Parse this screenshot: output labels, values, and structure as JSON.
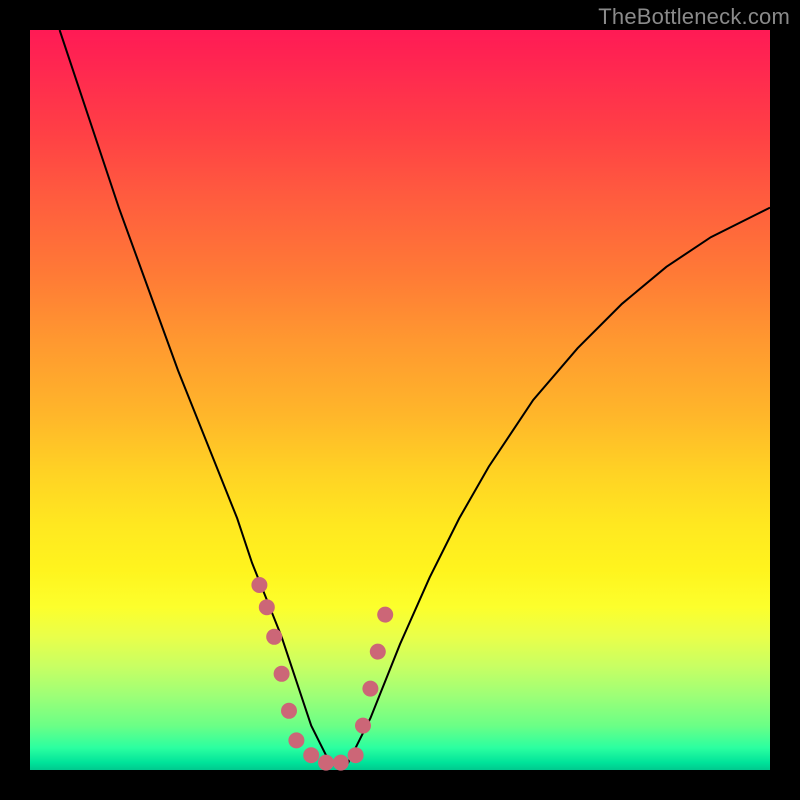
{
  "watermark": "TheBottleneck.com",
  "colors": {
    "background": "#000000",
    "curve": "#000000",
    "markers": "#cc6677",
    "gradient_top": "#ff1a55",
    "gradient_bottom": "#00c98e"
  },
  "chart_data": {
    "type": "line",
    "title": "",
    "xlabel": "",
    "ylabel": "",
    "xlim": [
      0,
      100
    ],
    "ylim": [
      0,
      100
    ],
    "x": [
      4,
      8,
      12,
      16,
      20,
      24,
      28,
      30,
      32,
      34,
      35,
      36,
      37,
      38,
      39,
      40,
      41,
      42,
      43,
      44,
      46,
      48,
      50,
      54,
      58,
      62,
      68,
      74,
      80,
      86,
      92,
      98,
      100
    ],
    "values": [
      100,
      88,
      76,
      65,
      54,
      44,
      34,
      28,
      23,
      18,
      15,
      12,
      9,
      6,
      4,
      2,
      1,
      0,
      1,
      3,
      7,
      12,
      17,
      26,
      34,
      41,
      50,
      57,
      63,
      68,
      72,
      75,
      76
    ],
    "marker_points": [
      {
        "x": 31,
        "y": 25
      },
      {
        "x": 32,
        "y": 22
      },
      {
        "x": 33,
        "y": 18
      },
      {
        "x": 34,
        "y": 13
      },
      {
        "x": 35,
        "y": 8
      },
      {
        "x": 36,
        "y": 4
      },
      {
        "x": 38,
        "y": 2
      },
      {
        "x": 40,
        "y": 1
      },
      {
        "x": 42,
        "y": 1
      },
      {
        "x": 44,
        "y": 2
      },
      {
        "x": 45,
        "y": 6
      },
      {
        "x": 46,
        "y": 11
      },
      {
        "x": 47,
        "y": 16
      },
      {
        "x": 48,
        "y": 21
      }
    ],
    "annotations": []
  }
}
